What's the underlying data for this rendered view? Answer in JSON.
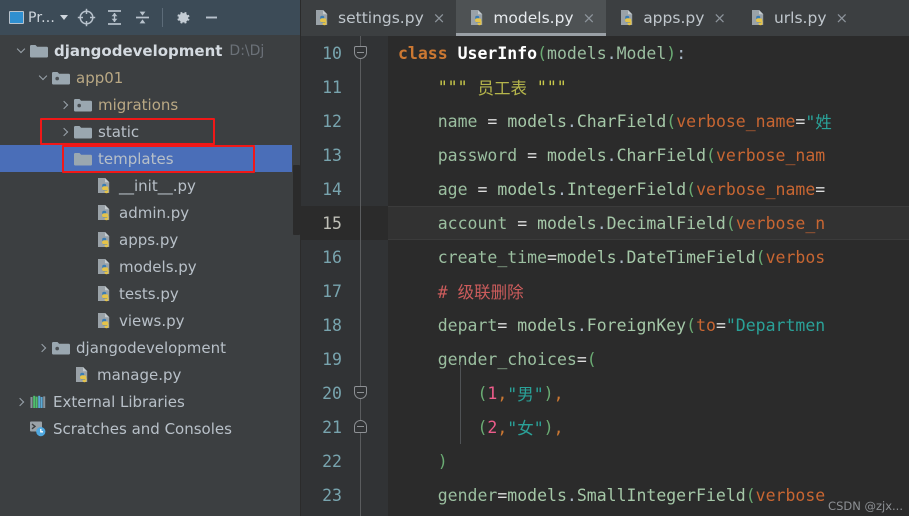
{
  "sidebar": {
    "toolbar": {
      "title": "Pr...",
      "window_icon": "project-window-icon",
      "dropdown_icon": "chevron-down-icon",
      "buttons": [
        {
          "name": "locate-icon",
          "glyph": "locate"
        },
        {
          "name": "expand-all-icon",
          "glyph": "expand-all"
        },
        {
          "name": "collapse-all-icon",
          "glyph": "collapse-all"
        },
        {
          "name": "settings-gear-icon",
          "glyph": "gear"
        },
        {
          "name": "hide-panel-icon",
          "glyph": "minus"
        }
      ]
    },
    "tree": [
      {
        "label": "djangodevelopment",
        "path": "D:\\Dj",
        "indent": 0,
        "arrow": "down",
        "icon": "folder",
        "style": "bold",
        "selected": false,
        "boxed": false
      },
      {
        "label": "app01",
        "path": "",
        "indent": 1,
        "arrow": "down",
        "icon": "module-folder",
        "style": "folder",
        "selected": false,
        "boxed": false
      },
      {
        "label": "migrations",
        "path": "",
        "indent": 2,
        "arrow": "right",
        "icon": "module-folder",
        "style": "folder",
        "selected": false,
        "boxed": false
      },
      {
        "label": "static",
        "path": "",
        "indent": 2,
        "arrow": "right",
        "icon": "folder",
        "style": "plain",
        "selected": false,
        "boxed": true
      },
      {
        "label": "templates",
        "path": "",
        "indent": 2,
        "arrow": "blank",
        "icon": "folder",
        "style": "plain",
        "selected": true,
        "boxed": true
      },
      {
        "label": "__init__.py",
        "path": "",
        "indent": 3,
        "arrow": "blank",
        "icon": "python",
        "style": "plain",
        "selected": false,
        "boxed": false
      },
      {
        "label": "admin.py",
        "path": "",
        "indent": 3,
        "arrow": "blank",
        "icon": "python",
        "style": "plain",
        "selected": false,
        "boxed": false
      },
      {
        "label": "apps.py",
        "path": "",
        "indent": 3,
        "arrow": "blank",
        "icon": "python",
        "style": "plain",
        "selected": false,
        "boxed": false
      },
      {
        "label": "models.py",
        "path": "",
        "indent": 3,
        "arrow": "blank",
        "icon": "python",
        "style": "plain",
        "selected": false,
        "boxed": false
      },
      {
        "label": "tests.py",
        "path": "",
        "indent": 3,
        "arrow": "blank",
        "icon": "python",
        "style": "plain",
        "selected": false,
        "boxed": false
      },
      {
        "label": "views.py",
        "path": "",
        "indent": 3,
        "arrow": "blank",
        "icon": "python",
        "style": "plain",
        "selected": false,
        "boxed": false
      },
      {
        "label": "djangodevelopment",
        "path": "",
        "indent": 1,
        "arrow": "right",
        "icon": "module-folder",
        "style": "plain",
        "selected": false,
        "boxed": false
      },
      {
        "label": "manage.py",
        "path": "",
        "indent": 2,
        "arrow": "blank",
        "icon": "python",
        "style": "plain",
        "selected": false,
        "boxed": false
      },
      {
        "label": "External Libraries",
        "path": "",
        "indent": 0,
        "arrow": "right",
        "icon": "libraries",
        "style": "plain",
        "selected": false,
        "boxed": false
      },
      {
        "label": "Scratches and Consoles",
        "path": "",
        "indent": 0,
        "arrow": "blank",
        "icon": "scratches",
        "style": "plain",
        "selected": false,
        "boxed": false
      }
    ]
  },
  "editor": {
    "tabs": [
      {
        "label": "settings.py",
        "active": false
      },
      {
        "label": "models.py",
        "active": true
      },
      {
        "label": "apps.py",
        "active": false
      },
      {
        "label": "urls.py",
        "active": false
      }
    ],
    "close_glyph": "×",
    "current_line": 15,
    "first_line_number": 10,
    "line_numbers": [
      10,
      11,
      12,
      13,
      14,
      15,
      16,
      17,
      18,
      19,
      20,
      21,
      22,
      23
    ],
    "lines": [
      {
        "n": 10,
        "tokens": [
          {
            "t": "class ",
            "c": "t-kw"
          },
          {
            "t": "UserInfo",
            "c": "t-cls"
          },
          {
            "t": "(",
            "c": "t-punc"
          },
          {
            "t": "models",
            "c": "t-id"
          },
          {
            "t": ".",
            "c": "t-txt"
          },
          {
            "t": "Model",
            "c": "t-id"
          },
          {
            "t": ")",
            "c": "t-punc"
          },
          {
            "t": ":",
            "c": "t-txt"
          }
        ]
      },
      {
        "n": 11,
        "tokens": [
          {
            "t": "    ",
            "c": "t-txt"
          },
          {
            "t": "\"\"\" ",
            "c": "t-doc"
          },
          {
            "t": "员工表",
            "c": "t-docz"
          },
          {
            "t": " \"\"\"",
            "c": "t-doc"
          }
        ]
      },
      {
        "n": 12,
        "tokens": [
          {
            "t": "    ",
            "c": "t-txt"
          },
          {
            "t": "name",
            "c": "t-id"
          },
          {
            "t": " = ",
            "c": "t-op"
          },
          {
            "t": "models",
            "c": "t-prop"
          },
          {
            "t": ".",
            "c": "t-txt"
          },
          {
            "t": "CharField",
            "c": "t-prop"
          },
          {
            "t": "(",
            "c": "t-punc"
          },
          {
            "t": "verbose_name",
            "c": "t-kwarg"
          },
          {
            "t": "=",
            "c": "t-op"
          },
          {
            "t": "\"姓",
            "c": "t-cstr"
          }
        ]
      },
      {
        "n": 13,
        "tokens": [
          {
            "t": "    ",
            "c": "t-txt"
          },
          {
            "t": "password",
            "c": "t-id"
          },
          {
            "t": " = ",
            "c": "t-op"
          },
          {
            "t": "models",
            "c": "t-prop"
          },
          {
            "t": ".",
            "c": "t-txt"
          },
          {
            "t": "CharField",
            "c": "t-prop"
          },
          {
            "t": "(",
            "c": "t-punc"
          },
          {
            "t": "verbose_nam",
            "c": "t-kwarg"
          }
        ]
      },
      {
        "n": 14,
        "tokens": [
          {
            "t": "    ",
            "c": "t-txt"
          },
          {
            "t": "age",
            "c": "t-id"
          },
          {
            "t": " = ",
            "c": "t-op"
          },
          {
            "t": "models",
            "c": "t-prop"
          },
          {
            "t": ".",
            "c": "t-txt"
          },
          {
            "t": "IntegerField",
            "c": "t-prop"
          },
          {
            "t": "(",
            "c": "t-punc"
          },
          {
            "t": "verbose_name",
            "c": "t-kwarg"
          },
          {
            "t": "=",
            "c": "t-op"
          }
        ]
      },
      {
        "n": 15,
        "tokens": [
          {
            "t": "    ",
            "c": "t-txt"
          },
          {
            "t": "account",
            "c": "t-id"
          },
          {
            "t": " = ",
            "c": "t-op"
          },
          {
            "t": "models",
            "c": "t-prop"
          },
          {
            "t": ".",
            "c": "t-txt"
          },
          {
            "t": "DecimalField",
            "c": "t-prop"
          },
          {
            "t": "(",
            "c": "t-punc"
          },
          {
            "t": "verbose_n",
            "c": "t-kwarg"
          }
        ]
      },
      {
        "n": 16,
        "tokens": [
          {
            "t": "    ",
            "c": "t-txt"
          },
          {
            "t": "create_time",
            "c": "t-id"
          },
          {
            "t": "=",
            "c": "t-op"
          },
          {
            "t": "models",
            "c": "t-prop"
          },
          {
            "t": ".",
            "c": "t-txt"
          },
          {
            "t": "DateTimeField",
            "c": "t-prop"
          },
          {
            "t": "(",
            "c": "t-punc"
          },
          {
            "t": "verbos",
            "c": "t-kwarg"
          }
        ]
      },
      {
        "n": 17,
        "tokens": [
          {
            "t": "    ",
            "c": "t-txt"
          },
          {
            "t": "# 级联删除",
            "c": "t-comment"
          }
        ]
      },
      {
        "n": 18,
        "tokens": [
          {
            "t": "    ",
            "c": "t-txt"
          },
          {
            "t": "depart",
            "c": "t-id"
          },
          {
            "t": "=",
            "c": "t-op"
          },
          {
            "t": " models",
            "c": "t-prop"
          },
          {
            "t": ".",
            "c": "t-txt"
          },
          {
            "t": "ForeignKey",
            "c": "t-prop"
          },
          {
            "t": "(",
            "c": "t-punc"
          },
          {
            "t": "to",
            "c": "t-kwarg"
          },
          {
            "t": "=",
            "c": "t-op"
          },
          {
            "t": "\"Departmen",
            "c": "t-cstr"
          }
        ]
      },
      {
        "n": 19,
        "tokens": [
          {
            "t": "    ",
            "c": "t-txt"
          },
          {
            "t": "gender_choices",
            "c": "t-id"
          },
          {
            "t": "=",
            "c": "t-op"
          },
          {
            "t": "(",
            "c": "t-punc"
          }
        ]
      },
      {
        "n": 20,
        "tokens": [
          {
            "t": "        ",
            "c": "t-txt"
          },
          {
            "t": "(",
            "c": "t-punc"
          },
          {
            "t": "1",
            "c": "t-num"
          },
          {
            "t": ",",
            "c": "t-comma"
          },
          {
            "t": "\"男\"",
            "c": "t-cstr"
          },
          {
            "t": ")",
            "c": "t-punc"
          },
          {
            "t": ",",
            "c": "t-comma"
          }
        ]
      },
      {
        "n": 21,
        "tokens": [
          {
            "t": "        ",
            "c": "t-txt"
          },
          {
            "t": "(",
            "c": "t-punc"
          },
          {
            "t": "2",
            "c": "t-num"
          },
          {
            "t": ",",
            "c": "t-comma"
          },
          {
            "t": "\"女\"",
            "c": "t-cstr"
          },
          {
            "t": ")",
            "c": "t-punc"
          },
          {
            "t": ",",
            "c": "t-comma"
          }
        ]
      },
      {
        "n": 22,
        "tokens": [
          {
            "t": "    ",
            "c": "t-txt"
          },
          {
            "t": ")",
            "c": "t-punc"
          }
        ]
      },
      {
        "n": 23,
        "tokens": [
          {
            "t": "    ",
            "c": "t-txt"
          },
          {
            "t": "gender",
            "c": "t-id"
          },
          {
            "t": "=",
            "c": "t-op"
          },
          {
            "t": "models",
            "c": "t-prop"
          },
          {
            "t": ".",
            "c": "t-txt"
          },
          {
            "t": "SmallIntegerField",
            "c": "t-prop"
          },
          {
            "t": "(",
            "c": "t-punc"
          },
          {
            "t": "verbose",
            "c": "t-kwarg"
          }
        ]
      }
    ]
  },
  "watermark": "CSDN @zjx..."
}
